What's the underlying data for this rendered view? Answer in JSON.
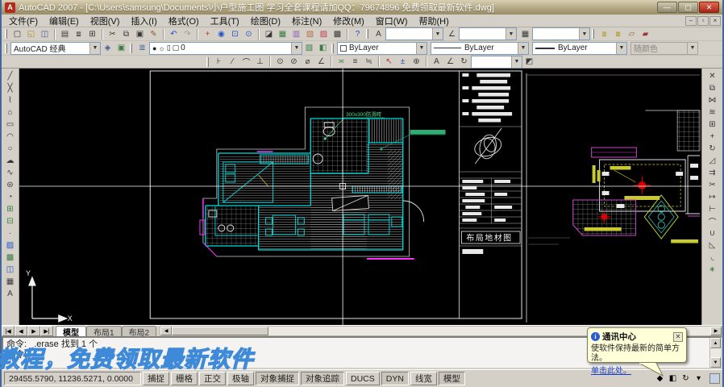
{
  "window": {
    "title": "AutoCAD 2007 - [C:\\Users\\samsung\\Documents\\小户型施工图 学习全套课程请加QQ：79674896 免费领取最新软件.dwg]",
    "minimize": "—",
    "maximize": "▢",
    "close": "✕"
  },
  "menu": {
    "items": [
      {
        "name": "menu-file",
        "label": "文件(F)"
      },
      {
        "name": "menu-edit",
        "label": "编辑(E)"
      },
      {
        "name": "menu-view",
        "label": "视图(V)"
      },
      {
        "name": "menu-insert",
        "label": "插入(I)"
      },
      {
        "name": "menu-format",
        "label": "格式(O)"
      },
      {
        "name": "menu-tools",
        "label": "工具(T)"
      },
      {
        "name": "menu-draw",
        "label": "绘图(D)"
      },
      {
        "name": "menu-dimension",
        "label": "标注(N)"
      },
      {
        "name": "menu-modify",
        "label": "修改(M)"
      },
      {
        "name": "menu-window",
        "label": "窗口(W)"
      },
      {
        "name": "menu-help",
        "label": "帮助(H)"
      }
    ],
    "doc_minimize": "–",
    "doc_restore": "▫",
    "doc_close": "×"
  },
  "toolbars": {
    "standard": [
      {
        "name": "qnew-icon",
        "glyph": "▢"
      },
      {
        "name": "open-icon",
        "glyph": "◱",
        "color": "#b08930"
      },
      {
        "name": "save-icon",
        "glyph": "◫",
        "color": "#445a96"
      },
      {
        "sep": true
      },
      {
        "name": "plot-icon",
        "glyph": "▤"
      },
      {
        "name": "plot-preview-icon",
        "glyph": "⧈"
      },
      {
        "name": "publish-icon",
        "glyph": "⊞"
      },
      {
        "sep": true
      },
      {
        "name": "cut-icon",
        "glyph": "✂"
      },
      {
        "name": "copy-clip-icon",
        "glyph": "⧉"
      },
      {
        "name": "paste-icon",
        "glyph": "▣"
      },
      {
        "name": "match-properties-icon",
        "glyph": "✎",
        "color": "#8a5a2a"
      },
      {
        "sep": true
      },
      {
        "name": "undo-icon",
        "glyph": "↶",
        "color": "#2156c8"
      },
      {
        "name": "redo-icon",
        "glyph": "↷",
        "color": "#9a9a9a"
      },
      {
        "sep": true
      },
      {
        "name": "pan-icon",
        "glyph": "+",
        "color": "#c0392b"
      },
      {
        "name": "zoom-realtime-icon",
        "glyph": "◉",
        "color": "#2156c8"
      },
      {
        "name": "zoom-window-icon",
        "glyph": "⊡",
        "color": "#2156c8"
      },
      {
        "name": "zoom-previous-icon",
        "glyph": "⊙",
        "color": "#2156c8"
      },
      {
        "sep": true
      },
      {
        "name": "properties-icon",
        "glyph": "◪"
      },
      {
        "name": "designcenter-icon",
        "glyph": "▦",
        "color": "#3a7d44"
      },
      {
        "name": "tool-palettes-icon",
        "glyph": "▥",
        "color": "#8a5fb0"
      },
      {
        "name": "sheet-set-manager-icon",
        "glyph": "▧",
        "color": "#b0714f"
      },
      {
        "name": "markup-set-manager-icon",
        "glyph": "▨",
        "color": "#c03f4f"
      },
      {
        "name": "quickcalc-icon",
        "glyph": "▩"
      },
      {
        "sep": true
      },
      {
        "name": "help-icon",
        "glyph": "?",
        "color": "#1a4fc0"
      }
    ],
    "style_combos": [
      {
        "name": "text-style-combo",
        "icon": "A"
      },
      {
        "name": "dim-style-combo",
        "icon": "∠"
      },
      {
        "name": "table-style-combo",
        "icon": "▦"
      }
    ],
    "layer_tools": [
      {
        "name": "make-object-layer-current-icon",
        "glyph": "⧆",
        "color": "#b0a030"
      },
      {
        "name": "layer-previous-icon",
        "glyph": "⧇",
        "color": "#b0a030"
      },
      {
        "name": "layer-state-icon",
        "glyph": "▱",
        "color": "#8a6a2a"
      },
      {
        "name": "layer-translate-icon",
        "glyph": "▰",
        "color": "#9a3a3a"
      }
    ],
    "workspace": {
      "value": "AutoCAD 经典"
    },
    "workspace_icons": [
      {
        "name": "workspace-settings-icon",
        "glyph": "◈",
        "color": "#445a96"
      },
      {
        "name": "my-workspace-icon",
        "glyph": "▣",
        "color": "#3a7d44"
      }
    ],
    "layer_manager_icon": {
      "glyph": "≣",
      "color": "#3a5f9e"
    },
    "layer_combo": {
      "value": "0",
      "icons": [
        {
          "name": "layer-on-icon",
          "glyph": "●",
          "color": "#e8c520"
        },
        {
          "name": "layer-thaw-icon",
          "glyph": "☼",
          "color": "#e8c520"
        },
        {
          "name": "layer-unlock-icon",
          "glyph": "▯",
          "color": "#777777"
        },
        {
          "name": "layer-color-swatch",
          "glyph": "▢",
          "color": "#999999"
        }
      ]
    },
    "layer_trailing_icons": [
      {
        "name": "layer-states-manager-icon",
        "glyph": "▧",
        "color": "#3a7d44"
      },
      {
        "name": "layer-isolate-icon",
        "glyph": "◧",
        "color": "#3a7d44"
      }
    ],
    "properties": {
      "color_label": "ByLayer",
      "linetype_label": "ByLayer",
      "lineweight_label": "ByLayer",
      "plotstyle_label": "随颜色"
    },
    "dimension": [
      {
        "name": "dim-linear-icon",
        "glyph": "⊦"
      },
      {
        "name": "dim-aligned-icon",
        "glyph": "∕"
      },
      {
        "name": "dim-arc-length-icon",
        "glyph": "⌒"
      },
      {
        "name": "dim-ordinate-icon",
        "glyph": "⊥"
      },
      {
        "sep": true
      },
      {
        "name": "dim-radius-icon",
        "glyph": "⊙"
      },
      {
        "name": "dim-jogged-icon",
        "glyph": "⊘"
      },
      {
        "name": "dim-diameter-icon",
        "glyph": "⌀"
      },
      {
        "name": "dim-angular-icon",
        "glyph": "∠"
      },
      {
        "sep": true
      },
      {
        "name": "quick-dimension-icon",
        "glyph": "≍",
        "color": "#3a7d44"
      },
      {
        "name": "dim-baseline-icon",
        "glyph": "≡"
      },
      {
        "name": "dim-continue-icon",
        "glyph": "≒"
      },
      {
        "sep": true
      },
      {
        "name": "quick-leader-icon",
        "glyph": "↖",
        "color": "#c0392b"
      },
      {
        "name": "tolerance-icon",
        "glyph": "±",
        "color": "#2156c8"
      },
      {
        "name": "center-mark-icon",
        "glyph": "⊕"
      },
      {
        "sep": true
      },
      {
        "name": "dim-edit-icon",
        "glyph": "A"
      },
      {
        "name": "dim-text-edit-icon",
        "glyph": "∠"
      },
      {
        "name": "dim-update-icon",
        "glyph": "↻"
      }
    ],
    "dim_style_icon": {
      "glyph": "◩"
    },
    "draw": [
      {
        "name": "line-icon",
        "glyph": "╱"
      },
      {
        "name": "construction-line-icon",
        "glyph": "╳"
      },
      {
        "name": "polyline-icon",
        "glyph": "⌇"
      },
      {
        "name": "polygon-icon",
        "glyph": "⌂"
      },
      {
        "name": "rectangle-icon",
        "glyph": "▭"
      },
      {
        "name": "arc-icon",
        "glyph": "◠"
      },
      {
        "name": "circle-icon",
        "glyph": "○"
      },
      {
        "name": "revision-cloud-icon",
        "glyph": "☁"
      },
      {
        "name": "spline-icon",
        "glyph": "∿"
      },
      {
        "name": "ellipse-icon",
        "glyph": "⊜"
      },
      {
        "name": "ellipse-arc-icon",
        "glyph": "◔"
      },
      {
        "name": "insert-block-icon",
        "glyph": "⊞",
        "color": "#3a7d44"
      },
      {
        "name": "make-block-icon",
        "glyph": "⊟",
        "color": "#3a7d44"
      },
      {
        "name": "point-icon",
        "glyph": "∙"
      },
      {
        "name": "hatch-icon",
        "glyph": "▨",
        "color": "#2156c8"
      },
      {
        "name": "gradient-icon",
        "glyph": "▩",
        "color": "#3a7d44"
      },
      {
        "name": "region-icon",
        "glyph": "◫",
        "color": "#2156c8"
      },
      {
        "name": "table-icon",
        "glyph": "▦"
      },
      {
        "name": "multiline-text-icon",
        "glyph": "A"
      }
    ],
    "modify": [
      {
        "name": "erase-icon",
        "glyph": "✕"
      },
      {
        "name": "copy-icon",
        "glyph": "⧉"
      },
      {
        "name": "mirror-icon",
        "glyph": "⋈"
      },
      {
        "name": "offset-icon",
        "glyph": "≋"
      },
      {
        "name": "array-icon",
        "glyph": "⊞"
      },
      {
        "name": "move-icon",
        "glyph": "+"
      },
      {
        "name": "rotate-icon",
        "glyph": "↻"
      },
      {
        "name": "scale-icon",
        "glyph": "◿"
      },
      {
        "name": "stretch-icon",
        "glyph": "⇉"
      },
      {
        "name": "trim-icon",
        "glyph": "✂"
      },
      {
        "name": "extend-icon",
        "glyph": "↦"
      },
      {
        "name": "break-at-point-icon",
        "glyph": "⊢"
      },
      {
        "name": "break-icon",
        "glyph": "⌒"
      },
      {
        "name": "join-icon",
        "glyph": "∪"
      },
      {
        "name": "chamfer-icon",
        "glyph": "◺"
      },
      {
        "name": "fillet-icon",
        "glyph": "◟"
      },
      {
        "name": "explode-icon",
        "glyph": "∗",
        "color": "#3a7d44"
      }
    ]
  },
  "tabs": {
    "nav": [
      {
        "name": "tab-first-button",
        "glyph": "|◀"
      },
      {
        "name": "tab-prev-button",
        "glyph": "◀"
      },
      {
        "name": "tab-next-button",
        "glyph": "▶"
      },
      {
        "name": "tab-last-button",
        "glyph": "▶|"
      }
    ],
    "items": [
      {
        "name": "tab-model",
        "label": "模型",
        "active": true
      },
      {
        "name": "tab-layout1",
        "label": "布局1"
      },
      {
        "name": "tab-layout2",
        "label": "布局2"
      }
    ],
    "scroll_left": "◀",
    "scroll_right": "▶"
  },
  "command": {
    "lines": [
      "命令: _.erase 找到 1 个",
      "命令:"
    ],
    "scroll_up": "▲",
    "scroll_down": "▼"
  },
  "watermark": {
    "text": "教程，免费领取最新软件"
  },
  "status": {
    "coords": "29455.5790, 11236.5271, 0.0000",
    "toggles": [
      {
        "name": "snap-toggle",
        "label": "捕捉"
      },
      {
        "name": "grid-toggle",
        "label": "栅格"
      },
      {
        "name": "ortho-toggle",
        "label": "正交"
      },
      {
        "name": "polar-toggle",
        "label": "极轴"
      },
      {
        "name": "osnap-toggle",
        "label": "对象捕捉",
        "on": true
      },
      {
        "name": "otrack-toggle",
        "label": "对象追踪",
        "on": true
      },
      {
        "name": "ducs-toggle",
        "label": "DUCS"
      },
      {
        "name": "dyn-toggle",
        "label": "DYN",
        "on": true
      },
      {
        "name": "lwt-toggle",
        "label": "线宽"
      },
      {
        "name": "model-toggle",
        "label": "模型",
        "on": true
      }
    ],
    "tray": [
      {
        "name": "communication-center-icon",
        "glyph": "◆",
        "color": "#e8b820"
      },
      {
        "name": "toolbar-lock-icon",
        "glyph": "◧",
        "color": "#8a8a8a"
      },
      {
        "name": "associated-standards-icon",
        "glyph": "↻",
        "color": "#2e9e3e"
      },
      {
        "name": "tray-arrow-icon",
        "glyph": "▾",
        "color": "#333333"
      }
    ]
  },
  "balloon": {
    "title": "通讯中心",
    "body": "使软件保持最新的简单方法。",
    "link": "单击此处。",
    "close": "✕"
  },
  "drawing": {
    "annotations": {
      "tile": "300x300防滑砖",
      "sheet_title": "布局地材图"
    },
    "ucs": {
      "x": "X",
      "y": "Y"
    },
    "colors": {
      "wall": "#00dcdc",
      "accent": "#ff30ff",
      "light": "#cc0000",
      "note": "#58d98f",
      "ceiling": "#c9c930"
    }
  }
}
